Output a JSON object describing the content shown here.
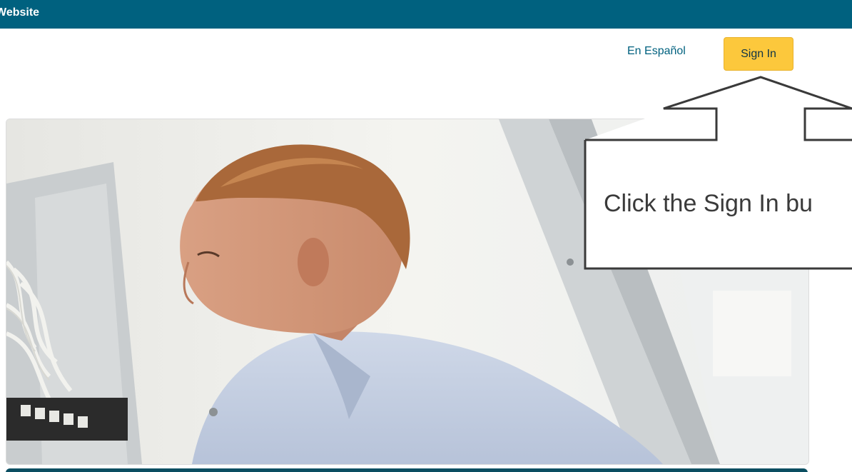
{
  "header": {
    "site_title": "Website"
  },
  "nav": {
    "lang_link": "En Español",
    "sign_in_label": "Sign In"
  },
  "hero": {
    "image_alt": "Technician working on network server rack"
  },
  "callout": {
    "text": "Click the Sign In bu"
  },
  "colors": {
    "header_bg": "#00617f",
    "sign_in_bg": "#fcc83c",
    "link": "#00617f"
  }
}
